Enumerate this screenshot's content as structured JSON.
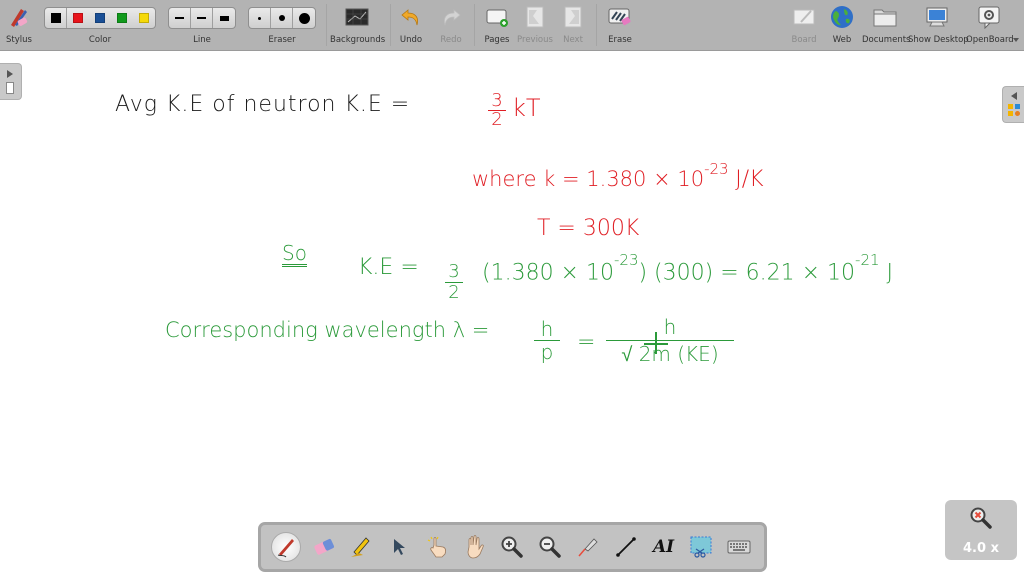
{
  "toolbar": {
    "stylus": {
      "label": "Stylus",
      "icon": "stylus-icon"
    },
    "color": {
      "label": "Color",
      "swatches": [
        "#000000",
        "#e8141b",
        "#1a4f96",
        "#119a1c",
        "#f5d90a"
      ]
    },
    "line": {
      "label": "Line",
      "options": [
        "thin",
        "medium",
        "thick"
      ]
    },
    "eraser": {
      "label": "Eraser",
      "options": [
        "small",
        "medium",
        "large"
      ]
    },
    "backgrounds": {
      "label": "Backgrounds",
      "icon": "backgrounds-icon"
    },
    "undo": {
      "label": "Undo",
      "icon": "undo-icon"
    },
    "redo": {
      "label": "Redo",
      "icon": "redo-icon",
      "disabled": true
    },
    "pages": {
      "label": "Pages",
      "icon": "add-page-icon"
    },
    "previous": {
      "label": "Previous",
      "icon": "previous-page-icon",
      "disabled": true
    },
    "next": {
      "label": "Next",
      "icon": "next-page-icon",
      "disabled": true
    },
    "erase": {
      "label": "Erase",
      "icon": "erase-all-icon"
    },
    "board": {
      "label": "Board",
      "icon": "board-icon",
      "disabled": true
    },
    "web": {
      "label": "Web",
      "icon": "globe-icon"
    },
    "documents": {
      "label": "Documents",
      "icon": "folder-icon"
    },
    "show_desktop": {
      "label": "Show Desktop",
      "icon": "monitor-icon"
    },
    "openboard": {
      "label": "OpenBoard",
      "icon": "openboard-settings-icon"
    }
  },
  "canvas": {
    "line1": {
      "text": "Avg  K.E  of  neutron  K.E = ",
      "frac_num": "3",
      "frac_den": "2",
      "tail": "kT"
    },
    "line2": {
      "text": "where k = 1.380 × 10",
      "exp": "-23",
      "unit": "J/K"
    },
    "line3": {
      "text": "T = 300K"
    },
    "line4": {
      "prefix": "So",
      "text": "K.E = ",
      "frac_num": "3",
      "frac_den": "2",
      "mid": "(1.380 × 10",
      "exp1": "-23",
      "mid2": ") (300) = 6.21 × 10",
      "exp2": "-21",
      "unit": "J"
    },
    "line5": {
      "text": "Corresponding  wavelength  λ = ",
      "frac1_num": "h",
      "frac1_den": "p",
      "eq": "=",
      "frac2_num": "h",
      "frac2_den": "√ 2m (KE)"
    }
  },
  "bottom_toolbar": {
    "tools": [
      "pen-tool-icon",
      "eraser-tool-icon",
      "highlighter-tool-icon",
      "pointer-tool-icon",
      "interact-tool-icon",
      "hand-tool-icon",
      "zoom-in-tool-icon",
      "zoom-out-tool-icon",
      "laser-pointer-tool-icon",
      "line-tool-icon",
      "text-tool-icon",
      "capture-tool-icon",
      "keyboard-tool-icon"
    ],
    "active": "pen-tool-icon",
    "text_tool_label": "AI"
  },
  "zoom": {
    "level": "4.0 x"
  }
}
